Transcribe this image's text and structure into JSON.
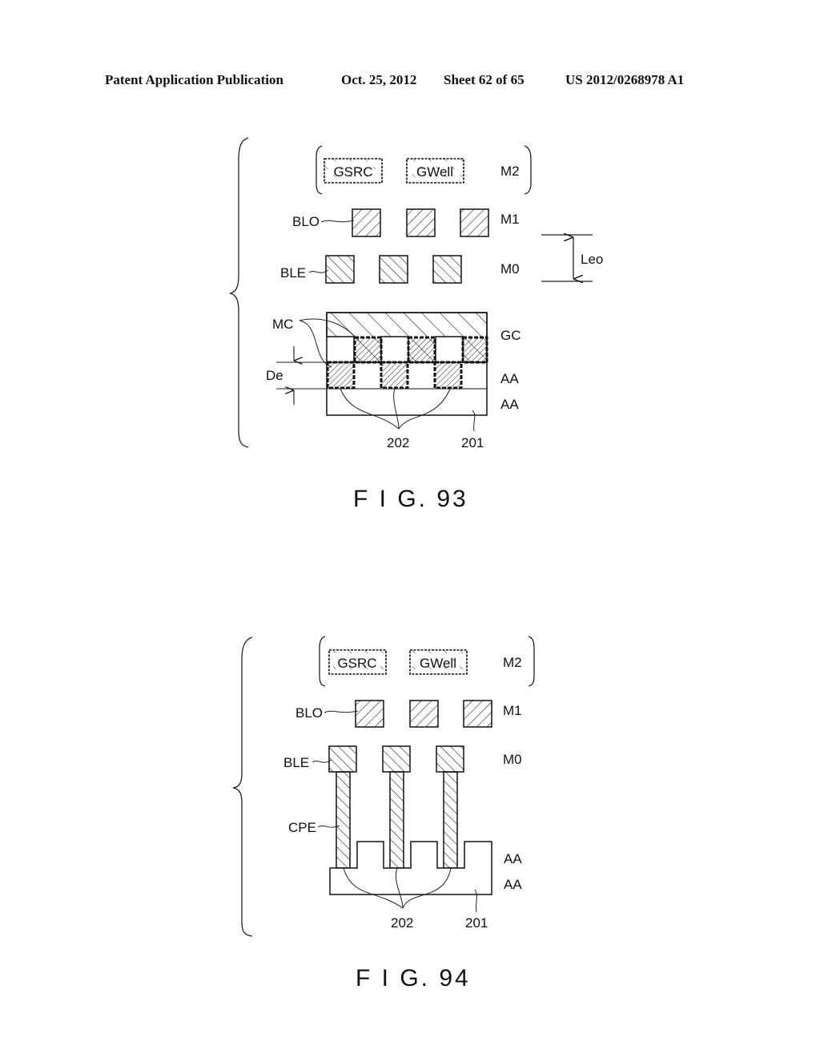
{
  "header": {
    "publication": "Patent Application Publication",
    "date": "Oct. 25, 2012",
    "sheet": "Sheet 62 of 65",
    "number": "US 2012/0268978 A1"
  },
  "figures": [
    {
      "caption": "F I G. 93",
      "m2_boxes": [
        "GSRC",
        "GWell"
      ],
      "layer_labels": {
        "m2": "M2",
        "m1": "M1",
        "m0": "M0",
        "gc": "GC",
        "aa_upper": "AA",
        "aa_lower": "AA"
      },
      "callouts": {
        "blo": "BLO",
        "ble": "BLE",
        "mc": "MC",
        "de": "De",
        "leo": "Leo",
        "ref_202": "202",
        "ref_201": "201"
      }
    },
    {
      "caption": "F I G. 94",
      "m2_boxes": [
        "GSRC",
        "GWell"
      ],
      "layer_labels": {
        "m2": "M2",
        "m1": "M1",
        "m0": "M0",
        "aa_upper": "AA",
        "aa_lower": "AA"
      },
      "callouts": {
        "blo": "BLO",
        "ble": "BLE",
        "cpe": "CPE",
        "ref_202": "202",
        "ref_201": "201"
      }
    }
  ]
}
